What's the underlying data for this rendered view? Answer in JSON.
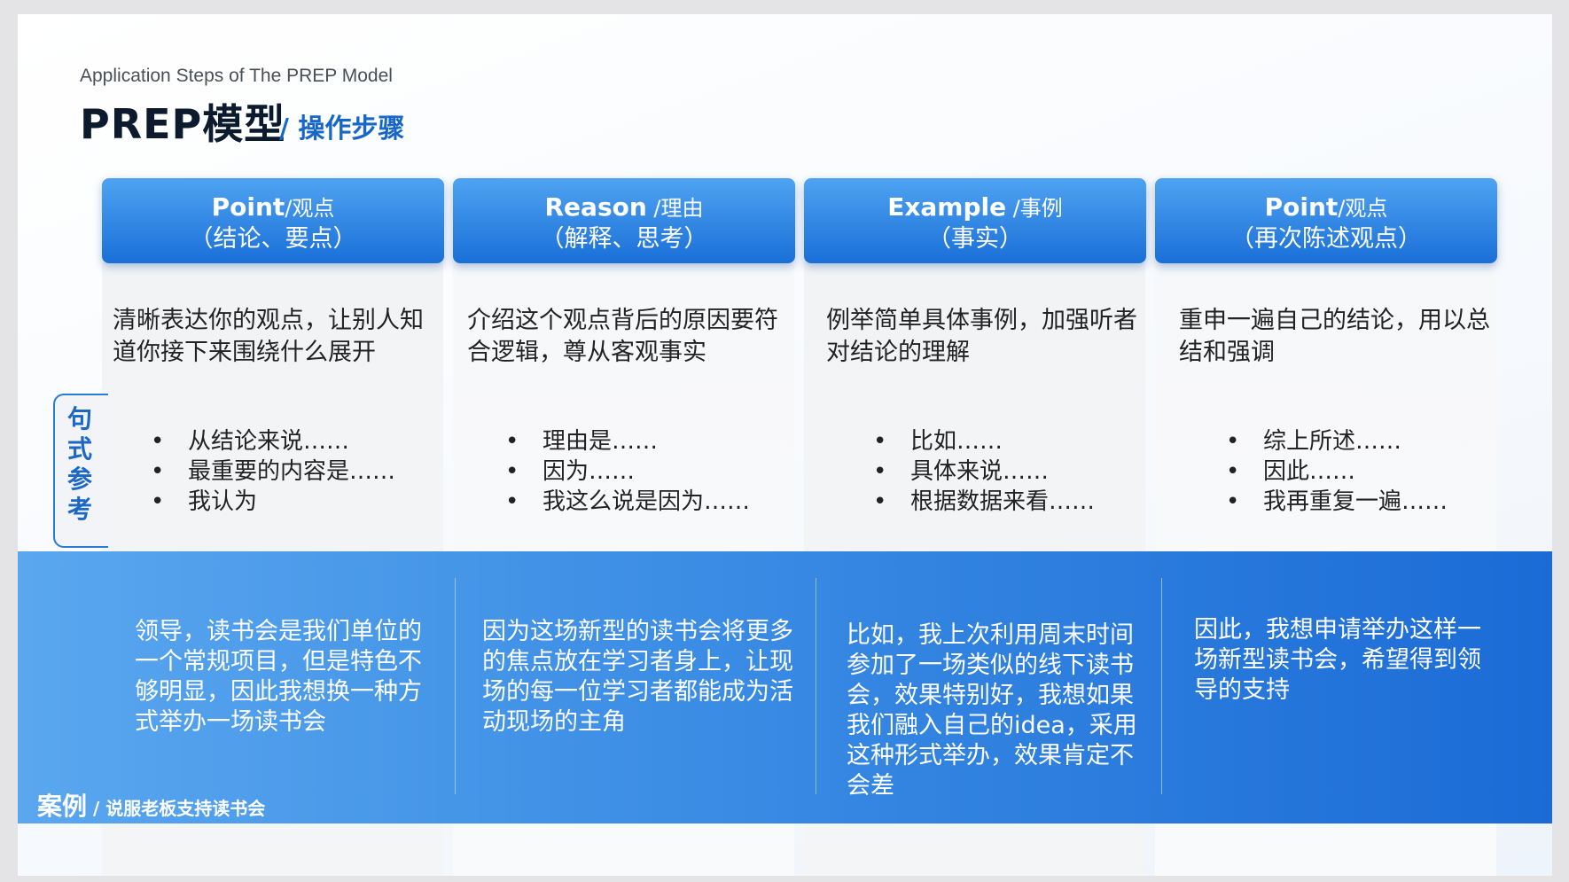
{
  "header": {
    "subtitle_en": "Application Steps of  The PREP Model",
    "title": "PREP模型",
    "title_sub": "/ 操作步骤"
  },
  "columns": [
    {
      "name": "Point",
      "name_suffix": "/观点",
      "sub": "（结论、要点）",
      "desc": "清晰表达你的观点，让别人知道你接下来围绕什么展开",
      "bullets": [
        "从结论来说……",
        "最重要的内容是……",
        "我认为"
      ],
      "case": "领导，读书会是我们单位的一个常规项目，但是特色不够明显，因此我想换一种方式举办一场读书会"
    },
    {
      "name": "Reason",
      "name_suffix": " /理由",
      "sub": "（解释、思考）",
      "desc": "介绍这个观点背后的原因要符合逻辑，尊从客观事实",
      "bullets": [
        "理由是……",
        "因为……",
        "我这么说是因为……"
      ],
      "case": "因为这场新型的读书会将更多的焦点放在学习者身上，让现场的每一位学习者都能成为活动现场的主角"
    },
    {
      "name": "Example",
      "name_suffix": " /事例",
      "sub": "（事实）",
      "desc": "例举简单具体事例，加强听者对结论的理解",
      "bullets": [
        "比如……",
        "具体来说……",
        "根据数据来看……"
      ],
      "case": "比如，我上次利用周末时间参加了一场类似的线下读书会，效果特别好，我想如果我们融入自己的idea，采用这种形式举办，效果肯定不会差"
    },
    {
      "name": "Point",
      "name_suffix": "/观点",
      "sub": "（再次陈述观点）",
      "desc": "重申一遍自己的结论，用以总结和强调",
      "bullets": [
        "综上所述……",
        "因此……",
        "我再重复一遍……"
      ],
      "case": "因此，我想申请举办这样一场新型读书会，希望得到领导的支持"
    }
  ],
  "ref_tag": "句式参考",
  "case_label": {
    "main": "案例",
    "sub": " / 说服老板支持读书会"
  }
}
